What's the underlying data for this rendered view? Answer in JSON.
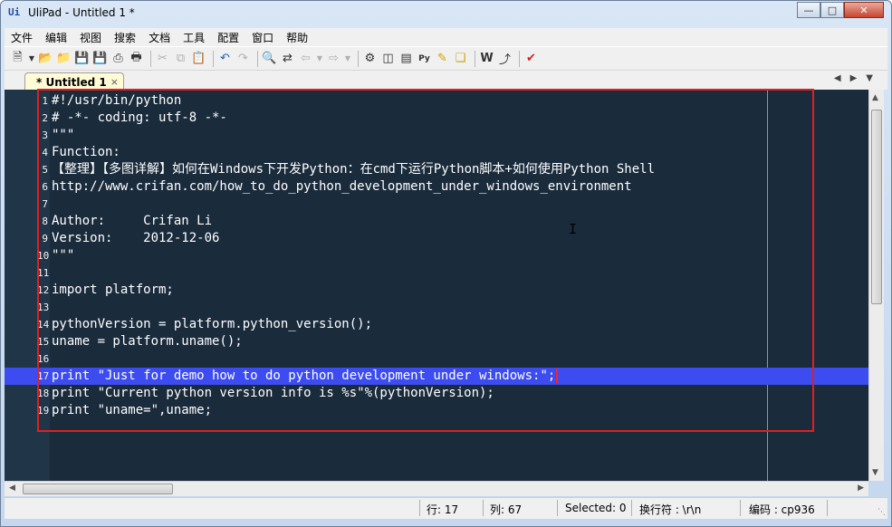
{
  "window": {
    "title": "UliPad - Untitled 1 *",
    "app_icon": "UliPad-icon",
    "controls": [
      "minimize-icon",
      "maximize-icon",
      "close-icon"
    ]
  },
  "menu": {
    "items": [
      "文件",
      "编辑",
      "视图",
      "搜索",
      "文档",
      "工具",
      "配置",
      "窗口",
      "帮助"
    ]
  },
  "toolbar": {
    "icons": [
      "new-file-icon",
      "dropdown-icon",
      "open-folder-icon",
      "open-icon",
      "save-icon",
      "save-all-icon",
      "print-icon",
      "print-preview-icon",
      "cut-icon",
      "copy-icon",
      "paste-icon",
      "undo-icon",
      "redo-icon",
      "find-icon",
      "replace-icon",
      "back-icon",
      "forward-icon",
      "preferences-icon",
      "pane-icon",
      "shell-icon",
      "python-icon",
      "comment-icon",
      "tag-icon",
      "wrap-icon",
      "run-icon",
      "check-icon"
    ]
  },
  "tab": {
    "label": "* Untitled 1",
    "close": "×"
  },
  "editor": {
    "current_line": 17,
    "lines": [
      {
        "num": "1",
        "text": "#!/usr/bin/python"
      },
      {
        "num": "2",
        "text": "# -*- coding: utf-8 -*-"
      },
      {
        "num": "3",
        "text": "\"\"\""
      },
      {
        "num": "4",
        "text": "Function:"
      },
      {
        "num": "5",
        "text": "【整理】【多图详解】如何在Windows下开发Python：在cmd下运行Python脚本+如何使用Python Shell"
      },
      {
        "num": "6",
        "text": "http://www.crifan.com/how_to_do_python_development_under_windows_environment"
      },
      {
        "num": "7",
        "text": ""
      },
      {
        "num": "8",
        "text": "Author:     Crifan Li"
      },
      {
        "num": "9",
        "text": "Version:    2012-12-06"
      },
      {
        "num": "10",
        "text": "\"\"\""
      },
      {
        "num": "11",
        "text": ""
      },
      {
        "num": "12",
        "text": "import platform;"
      },
      {
        "num": "13",
        "text": ""
      },
      {
        "num": "14",
        "text": "pythonVersion = platform.python_version();"
      },
      {
        "num": "15",
        "text": "uname = platform.uname();"
      },
      {
        "num": "16",
        "text": ""
      },
      {
        "num": "17",
        "text": "print \"Just for demo how to do python development under windows:\";"
      },
      {
        "num": "18",
        "text": "print \"Current python version info is %s\"%(pythonVersion);"
      },
      {
        "num": "19",
        "text": "print \"uname=\",uname;"
      }
    ]
  },
  "status": {
    "row": "行: 17",
    "col": "列: 67",
    "selected": "Selected: 0",
    "eol": "换行符 : \\r\\n",
    "encoding": "编码 : cp936"
  },
  "colors": {
    "editor_bg": "#1a2b3c",
    "current_line": "#3c4cf0",
    "annotation_box": "#e02020"
  }
}
